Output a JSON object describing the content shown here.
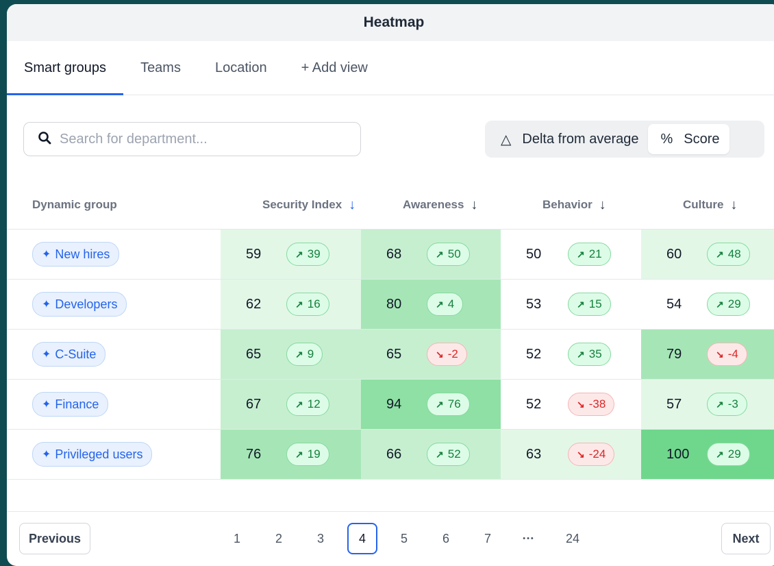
{
  "window": {
    "title": "Heatmap"
  },
  "tabs": [
    {
      "label": "Smart groups",
      "active": true
    },
    {
      "label": "Teams",
      "active": false
    },
    {
      "label": "Location",
      "active": false
    },
    {
      "label": "+ Add view",
      "active": false
    }
  ],
  "search": {
    "placeholder": "Search for department...",
    "value": "",
    "icon": "search-icon"
  },
  "view_toggle": {
    "options": [
      {
        "label": "Delta from average",
        "icon": "delta-icon",
        "selected": false
      },
      {
        "label": "Score",
        "icon": "percent-icon",
        "selected": true
      }
    ]
  },
  "table": {
    "columns": [
      {
        "label": "Dynamic group"
      },
      {
        "label": "Security Index",
        "sort": "desc",
        "sort_color": "#2563eb"
      },
      {
        "label": "Awareness",
        "sort": "desc"
      },
      {
        "label": "Behavior",
        "sort": "desc"
      },
      {
        "label": "Culture",
        "sort": "desc"
      }
    ],
    "rows": [
      {
        "group": "New hires",
        "cells": [
          {
            "score": "59",
            "delta": "39",
            "trend": "up",
            "bg": "#e3f7e7"
          },
          {
            "score": "68",
            "delta": "50",
            "trend": "up",
            "bg": "#c6efd0"
          },
          {
            "score": "50",
            "delta": "21",
            "trend": "up",
            "bg": "#ffffff"
          },
          {
            "score": "60",
            "delta": "48",
            "trend": "up",
            "bg": "#e3f7e7"
          }
        ]
      },
      {
        "group": "Developers",
        "cells": [
          {
            "score": "62",
            "delta": "16",
            "trend": "up",
            "bg": "#e3f7e7"
          },
          {
            "score": "80",
            "delta": "4",
            "trend": "up",
            "bg": "#a6e6b6"
          },
          {
            "score": "53",
            "delta": "15",
            "trend": "up",
            "bg": "#ffffff"
          },
          {
            "score": "54",
            "delta": "29",
            "trend": "up",
            "bg": "#ffffff"
          }
        ]
      },
      {
        "group": "C-Suite",
        "cells": [
          {
            "score": "65",
            "delta": "9",
            "trend": "up",
            "bg": "#c6efd0"
          },
          {
            "score": "65",
            "delta": "-2",
            "trend": "down",
            "bg": "#c6efd0"
          },
          {
            "score": "52",
            "delta": "35",
            "trend": "up",
            "bg": "#ffffff"
          },
          {
            "score": "79",
            "delta": "-4",
            "trend": "down",
            "bg": "#a6e6b6"
          }
        ]
      },
      {
        "group": "Finance",
        "cells": [
          {
            "score": "67",
            "delta": "12",
            "trend": "up",
            "bg": "#c6efd0"
          },
          {
            "score": "94",
            "delta": "76",
            "trend": "up",
            "bg": "#8ee0a4"
          },
          {
            "score": "52",
            "delta": "-38",
            "trend": "down",
            "bg": "#ffffff"
          },
          {
            "score": "57",
            "delta": "-3",
            "trend": "up",
            "bg": "#e3f7e7"
          }
        ]
      },
      {
        "group": "Privileged users",
        "cells": [
          {
            "score": "76",
            "delta": "19",
            "trend": "up",
            "bg": "#a6e6b6"
          },
          {
            "score": "66",
            "delta": "52",
            "trend": "up",
            "bg": "#c6efd0"
          },
          {
            "score": "63",
            "delta": "-24",
            "trend": "down",
            "bg": "#e3f7e7"
          },
          {
            "score": "100",
            "delta": "29",
            "trend": "up",
            "bg": "#6fd78c"
          }
        ]
      }
    ]
  },
  "pagination": {
    "previous": "Previous",
    "next": "Next",
    "pages": [
      "1",
      "2",
      "3",
      "4",
      "5",
      "6",
      "7",
      "•••",
      "24"
    ],
    "current": "4"
  }
}
